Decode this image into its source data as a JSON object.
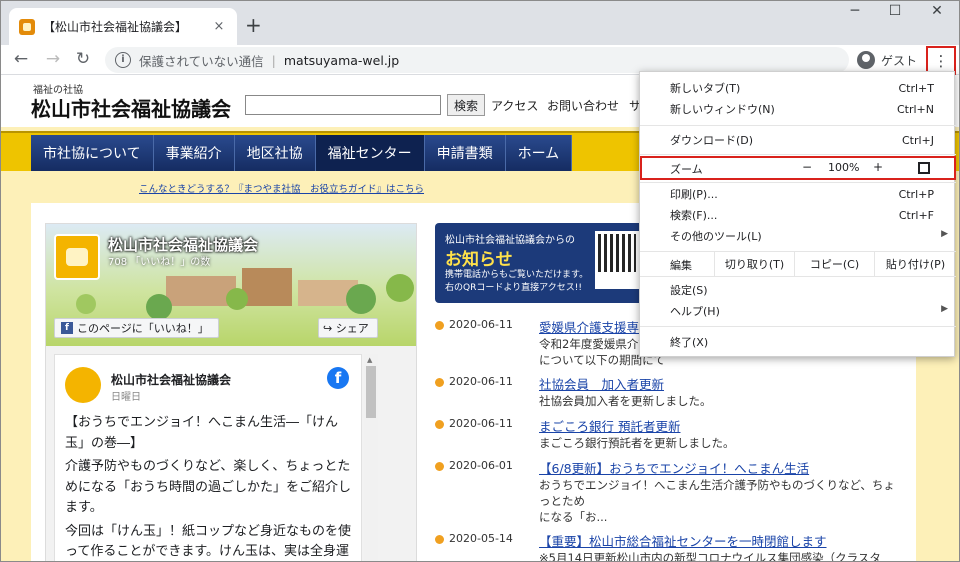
{
  "browser": {
    "tab_title": "【松山市社会福祉協議会】",
    "tab_close": "×",
    "new_tab": "+",
    "security": "保護されていない通信",
    "url": "matsuyama-wel.jp",
    "guest": "ゲスト",
    "menu_icon": "⋮"
  },
  "site": {
    "logo_sub": "福祉の社協",
    "logo_main": "松山市社会福祉協議会",
    "search_button": "検索",
    "header_links": [
      "アクセス",
      "お問い合わせ",
      "サ"
    ],
    "nav": [
      "市社協について",
      "事業紹介",
      "地区社協",
      "福祉センター",
      "申請書類",
      "ホーム"
    ],
    "help_link": "こんなときどうする？『まつやま社協　お役立ちガイド』はこちら"
  },
  "facebook": {
    "page_name": "松山市社会福祉協議会",
    "likes": "708 「いいね！」の数",
    "like_button": "このページに「いいね！」",
    "share_button": "シェア",
    "post_author": "松山市社会福祉協議会",
    "post_date": "日曜日",
    "post_body": [
      "【おうちでエンジョイ！へこまん生活―「けん玉」の巻―】",
      "介護予防やものづくりなど、楽しく、ちょっとためになる「おうち時間の過ごしかた」をご紹介します。",
      "今回は「けん玉」！紙コップなど身近なものを使って作ることができます。けん玉は、実は全身運動です。自然とひざの曲げ伸ばしをするため、ス"
    ]
  },
  "news_banner": {
    "line1": "松山市社会福祉協議会からの",
    "line2": "お知らせ",
    "line3": "携帯電話からもご覧いただけます。",
    "line4": "右のQRコードより直接アクセス!!"
  },
  "news": [
    {
      "date": "2020-06-11",
      "title": "愛媛県介護支援専門",
      "desc": "令和2年度愛媛県介護支援専門員\nについて以下の期間にて"
    },
    {
      "date": "2020-06-11",
      "title": "社協会員　加入者更新",
      "desc": "社協会員加入者を更新しました。"
    },
    {
      "date": "2020-06-11",
      "title": "まごころ銀行 預託者更新",
      "desc": "まごころ銀行預託者を更新しました。"
    },
    {
      "date": "2020-06-01",
      "title": "【6/8更新】おうちでエンジョイ！へこまん生活",
      "desc": "おうちでエンジョイ！へこまん生活介護予防やものづくりなど、ちょっとため\nになる「お..."
    },
    {
      "date": "2020-05-14",
      "title": "【重要】松山市総合福祉センターを一時閉館します",
      "desc": "※5月14日更新松山市内の新型コロナウイルス集団感染（クラスタ\nー）の発生に伴い、..."
    }
  ],
  "menu": {
    "new_tab": "新しいタブ(T)",
    "new_tab_sc": "Ctrl+T",
    "new_window": "新しいウィンドウ(N)",
    "new_window_sc": "Ctrl+N",
    "downloads": "ダウンロード(D)",
    "downloads_sc": "Ctrl+J",
    "zoom": "ズーム",
    "zoom_minus": "−",
    "zoom_value": "100%",
    "zoom_plus": "+",
    "print": "印刷(P)...",
    "print_sc": "Ctrl+P",
    "find": "検索(F)...",
    "find_sc": "Ctrl+F",
    "more_tools": "その他のツール(L)",
    "edit": "編集",
    "cut": "切り取り(T)",
    "copy": "コピー(C)",
    "paste": "貼り付け(P)",
    "settings": "設定(S)",
    "help": "ヘルプ(H)",
    "exit": "終了(X)"
  }
}
